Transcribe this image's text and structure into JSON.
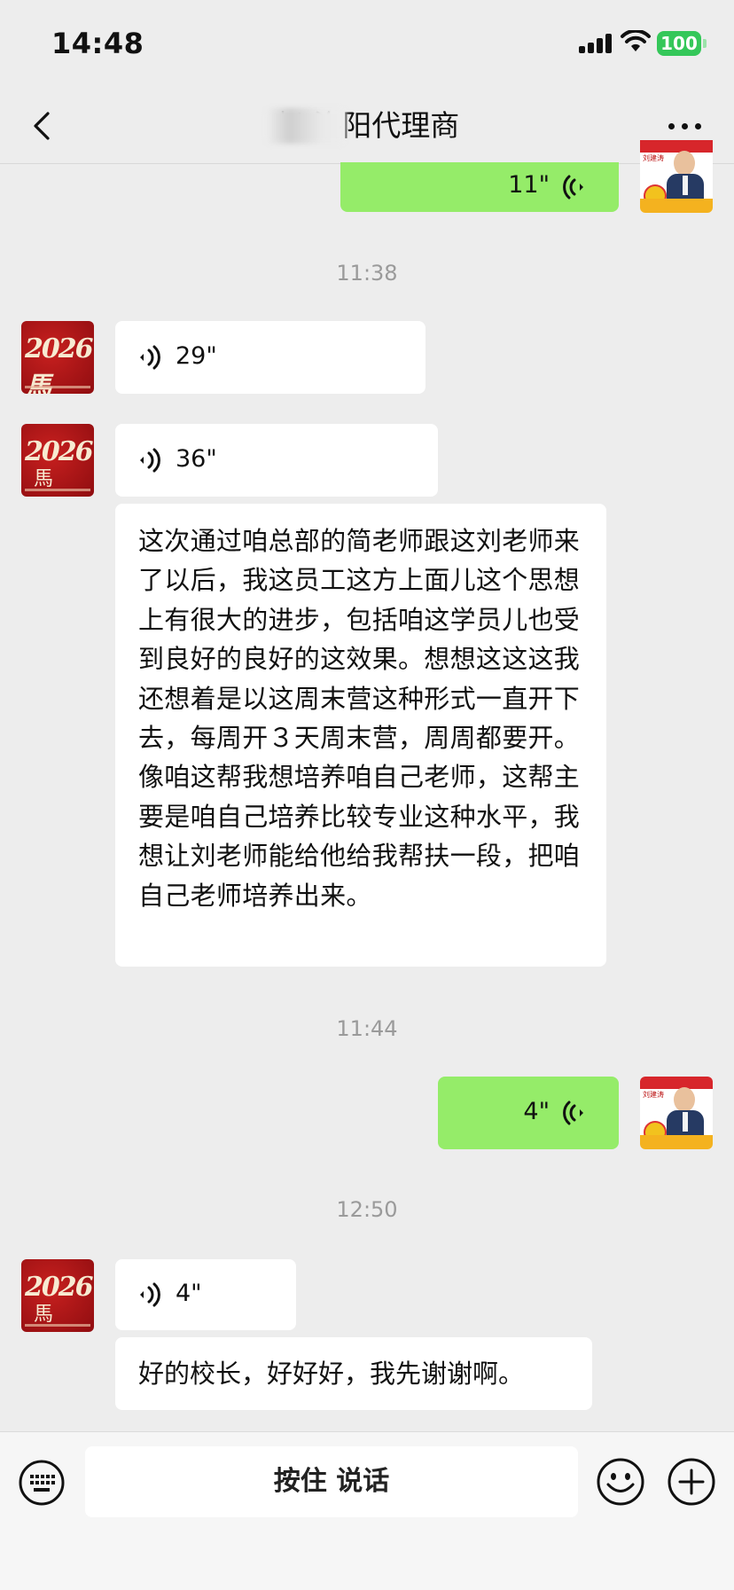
{
  "status_bar": {
    "time": "14:48",
    "battery": "100"
  },
  "nav": {
    "title": "赵    洛阳代理商"
  },
  "messages": {
    "m1": {
      "duration": "11\""
    },
    "t1": "11:38",
    "m2": {
      "duration": "29\""
    },
    "m3": {
      "duration": "36\""
    },
    "m3_transcript": "这次通过咱总部的简老师跟这刘老师来了以后，我这员工这方上面儿这个思想上有很大的进步，包括咱这学员儿也受到良好的良好的这效果。想想这这这我还想着是以这周末营这种形式一直开下去，每周开３天周末营，周周都要开。像咱这帮我想培养咱自己老师，这帮主要是咱自己培养比较专业这种水平，我想让刘老师能给他给我帮扶一段，把咱自己老师培养出来。",
    "t2": "11:44",
    "m4": {
      "duration": "4\""
    },
    "t3": "12:50",
    "m5": {
      "duration": "4\""
    },
    "m5_transcript": "好的校长，好好好，我先谢谢啊。"
  },
  "avatars": {
    "contact_text": "2026 馬",
    "self_name": "刘建涛"
  },
  "input": {
    "hold_to_talk": "按住 说话"
  },
  "colors": {
    "background": "#ededed",
    "self_bubble": "#95ec69",
    "other_bubble": "#ffffff"
  }
}
